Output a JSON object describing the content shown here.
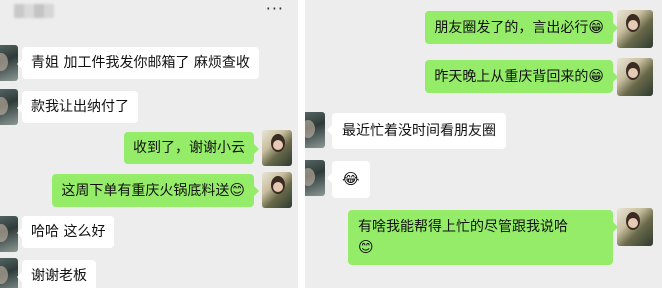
{
  "left_chat": {
    "more_icon": "···",
    "messages": [
      {
        "side": "received",
        "text": "青姐 加工件我发你邮箱了 麻烦查收"
      },
      {
        "side": "received",
        "text": "款我让出纳付了"
      },
      {
        "side": "sent",
        "text": "收到了，谢谢小云"
      },
      {
        "side": "sent",
        "text": "这周下单有重庆火锅底料送",
        "emoji": "😊"
      },
      {
        "side": "received",
        "text": "哈哈 这么好"
      },
      {
        "side": "received",
        "text": "谢谢老板"
      }
    ]
  },
  "right_chat": {
    "messages": [
      {
        "side": "sent",
        "text": "朋友圈发了的，言出必行",
        "emoji": "😁"
      },
      {
        "side": "sent",
        "text": "昨天晚上从重庆背回来的",
        "emoji": "😁"
      },
      {
        "side": "received",
        "text": "最近忙着没时间看朋友圈"
      },
      {
        "side": "received",
        "emoji": "😂"
      },
      {
        "side": "sent",
        "text": "有啥我能帮得上忙的尽管跟我说哈",
        "emoji": "😊"
      }
    ]
  }
}
